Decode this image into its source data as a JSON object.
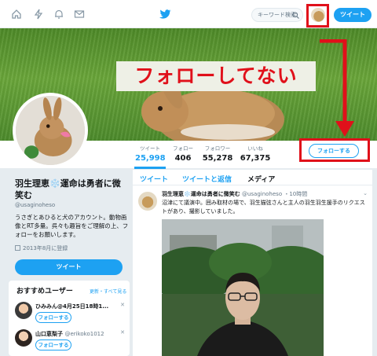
{
  "topbar": {
    "search_placeholder": "キーワード検索",
    "tweet_button": "ツイート",
    "colors": {
      "brand": "#1da1f2",
      "highlight": "#e0101a"
    }
  },
  "banner": {
    "caption": "フォローしてない"
  },
  "stats": {
    "items": [
      {
        "label": "ツイート",
        "value": "25,998"
      },
      {
        "label": "フォロー",
        "value": "406"
      },
      {
        "label": "フォロワー",
        "value": "55,278"
      },
      {
        "label": "いいね",
        "value": "67,375"
      }
    ],
    "follow_button": "フォローする"
  },
  "profile": {
    "name": "羽生理恵❄️運命は勇者に微笑む",
    "handle": "@usaginoheso",
    "bio": "うさぎとあひると犬のアカウント。動物画像とRT多量。呉々も趣旨をご理解の上、フォローをお願いします。",
    "joined": "2013年8月に登録",
    "tweet_button": "ツイート"
  },
  "who_to_follow": {
    "title": "おすすめユーザー",
    "links": "更新・すべて見る",
    "users": [
      {
        "name": "ひみみん@4月25日18時1...",
        "handle": "",
        "follow": "フォローする"
      },
      {
        "name": "山口恵梨子",
        "handle": "@erikoko1012",
        "follow": "フォローする"
      }
    ]
  },
  "timeline": {
    "tabs": [
      "ツイート",
      "ツイートと返信",
      "メディア"
    ],
    "tweet": {
      "name": "羽生理恵❄️運命は勇者に微笑む",
      "handle": "@usaginoheso",
      "time": "・10時間",
      "text": "沼津にて議演中。囲み取材の場で、羽生猫弦さんと主人の羽生羽生援手のリクエストがあり、撮影していました。"
    }
  }
}
